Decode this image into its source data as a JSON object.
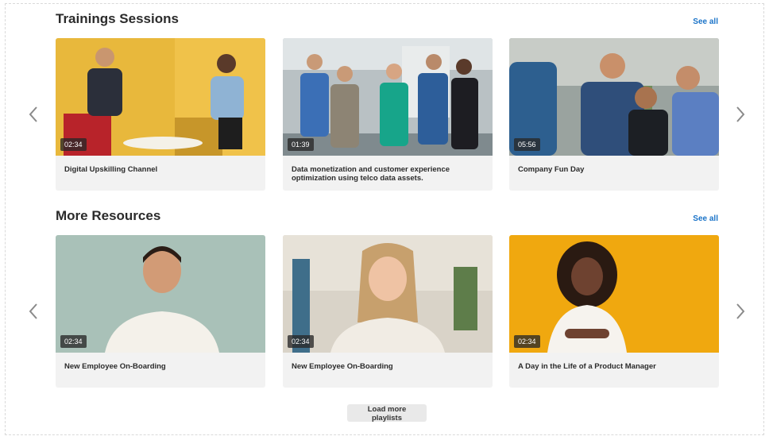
{
  "sections": [
    {
      "title": "Trainings Sessions",
      "see_all": "See all",
      "cards": [
        {
          "title": "Digital Upskilling Channel",
          "duration": "02:34"
        },
        {
          "title": "Data monetization and customer experience optimization using telco data assets.",
          "duration": "01:39"
        },
        {
          "title": "Company Fun Day",
          "duration": "05:56"
        }
      ]
    },
    {
      "title": "More Resources",
      "see_all": "See all",
      "cards": [
        {
          "title": "New Employee On-Boarding",
          "duration": "02:34"
        },
        {
          "title": "New Employee On-Boarding",
          "duration": "02:34"
        },
        {
          "title": "A Day in the Life of a Product Manager",
          "duration": "02:34"
        }
      ]
    }
  ],
  "load_more_label": "Load more playlists",
  "colors": {
    "accent": "#1a73c8",
    "card_bg": "#f2f2f2",
    "button_bg": "#e9e9e9",
    "arrow": "#8a8a8a"
  },
  "icons": {
    "prev": "chevron-left-icon",
    "next": "chevron-right-icon"
  }
}
